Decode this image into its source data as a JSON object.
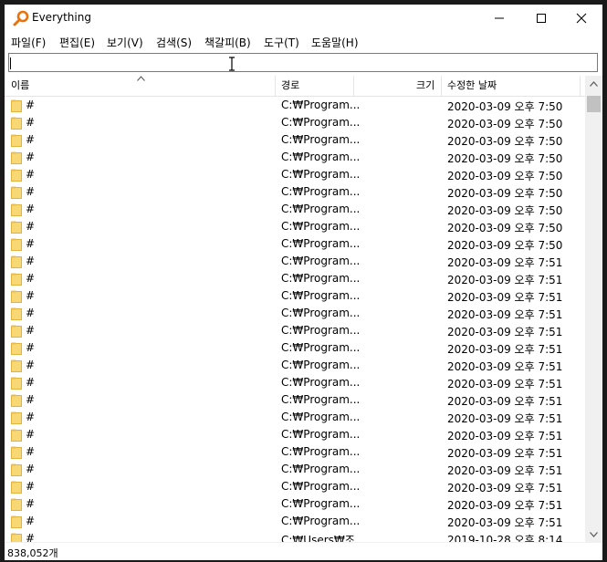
{
  "window": {
    "title": "Everything"
  },
  "menu": [
    "파일(F)",
    "편집(E)",
    "보기(V)",
    "검색(S)",
    "책갈피(B)",
    "도구(T)",
    "도움말(H)"
  ],
  "search": {
    "value": ""
  },
  "columns": {
    "name": "이름",
    "path": "경로",
    "size": "크기",
    "modified": "수정한 날짜"
  },
  "rows": [
    {
      "name": "#",
      "path": "C:₩Program...",
      "date": "2020-03-09 오후 7:50"
    },
    {
      "name": "#",
      "path": "C:₩Program...",
      "date": "2020-03-09 오후 7:50"
    },
    {
      "name": "#",
      "path": "C:₩Program...",
      "date": "2020-03-09 오후 7:50"
    },
    {
      "name": "#",
      "path": "C:₩Program...",
      "date": "2020-03-09 오후 7:50"
    },
    {
      "name": "#",
      "path": "C:₩Program...",
      "date": "2020-03-09 오후 7:50"
    },
    {
      "name": "#",
      "path": "C:₩Program...",
      "date": "2020-03-09 오후 7:50"
    },
    {
      "name": "#",
      "path": "C:₩Program...",
      "date": "2020-03-09 오후 7:50"
    },
    {
      "name": "#",
      "path": "C:₩Program...",
      "date": "2020-03-09 오후 7:50"
    },
    {
      "name": "#",
      "path": "C:₩Program...",
      "date": "2020-03-09 오후 7:50"
    },
    {
      "name": "#",
      "path": "C:₩Program...",
      "date": "2020-03-09 오후 7:51"
    },
    {
      "name": "#",
      "path": "C:₩Program...",
      "date": "2020-03-09 오후 7:51"
    },
    {
      "name": "#",
      "path": "C:₩Program...",
      "date": "2020-03-09 오후 7:51"
    },
    {
      "name": "#",
      "path": "C:₩Program...",
      "date": "2020-03-09 오후 7:51"
    },
    {
      "name": "#",
      "path": "C:₩Program...",
      "date": "2020-03-09 오후 7:51"
    },
    {
      "name": "#",
      "path": "C:₩Program...",
      "date": "2020-03-09 오후 7:51"
    },
    {
      "name": "#",
      "path": "C:₩Program...",
      "date": "2020-03-09 오후 7:51"
    },
    {
      "name": "#",
      "path": "C:₩Program...",
      "date": "2020-03-09 오후 7:51"
    },
    {
      "name": "#",
      "path": "C:₩Program...",
      "date": "2020-03-09 오후 7:51"
    },
    {
      "name": "#",
      "path": "C:₩Program...",
      "date": "2020-03-09 오후 7:51"
    },
    {
      "name": "#",
      "path": "C:₩Program...",
      "date": "2020-03-09 오후 7:51"
    },
    {
      "name": "#",
      "path": "C:₩Program...",
      "date": "2020-03-09 오후 7:51"
    },
    {
      "name": "#",
      "path": "C:₩Program...",
      "date": "2020-03-09 오후 7:51"
    },
    {
      "name": "#",
      "path": "C:₩Program...",
      "date": "2020-03-09 오후 7:51"
    },
    {
      "name": "#",
      "path": "C:₩Program...",
      "date": "2020-03-09 오후 7:51"
    },
    {
      "name": "#",
      "path": "C:₩Program...",
      "date": "2020-03-09 오후 7:51"
    },
    {
      "name": "#",
      "path": "C:₩Users₩조...",
      "date": "2019-10-28 오후 8:14"
    }
  ],
  "status": {
    "count": "838,052개"
  },
  "colors": {
    "folder": "#f8d775",
    "folder_edge": "#e0b440",
    "icon_orange": "#e8730c",
    "scroll_thumb": "#c1c1c1"
  },
  "icons": {
    "app": "magnifier-icon",
    "minimize": "minimize-icon",
    "maximize": "maximize-icon",
    "close": "close-icon",
    "folder": "folder-icon"
  }
}
